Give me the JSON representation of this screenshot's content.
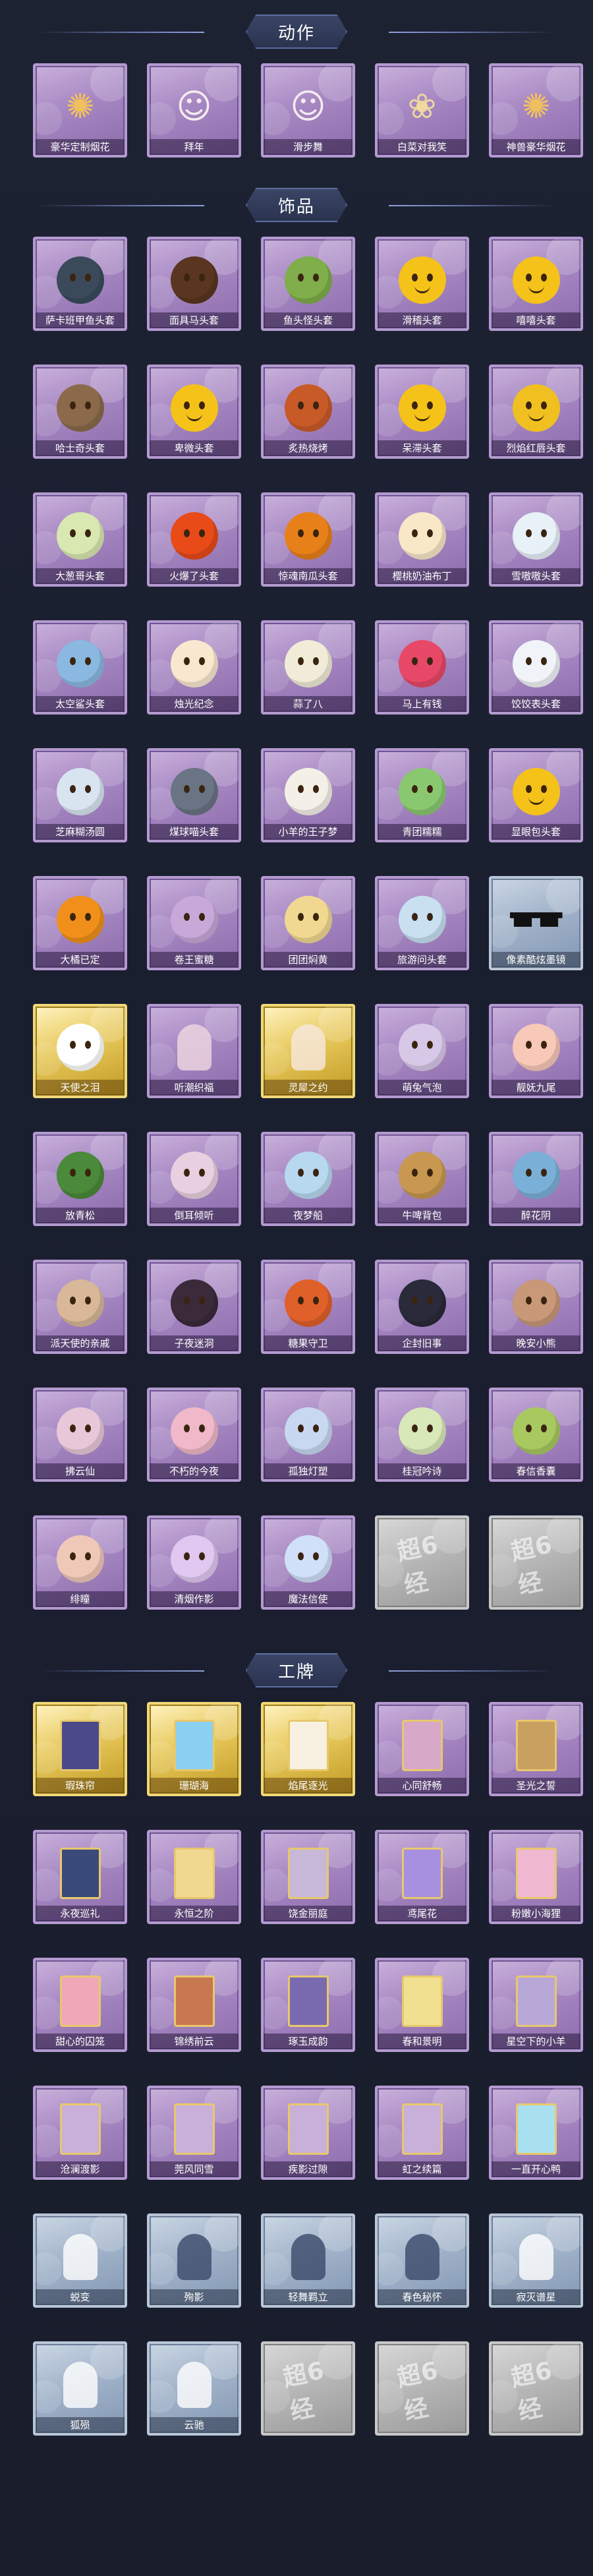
{
  "sections": [
    {
      "title": "动作",
      "items": [
        {
          "label": "豪华定制烟花",
          "style": "purple",
          "icon": "firework-icon"
        },
        {
          "label": "拜年",
          "style": "purple",
          "icon": "bowing-figure-icon"
        },
        {
          "label": "滑步舞",
          "style": "purple",
          "icon": "dancing-figure-icon"
        },
        {
          "label": "白菜对我笑",
          "style": "purple",
          "icon": "cabbage-smile-icon"
        },
        {
          "label": "神兽豪华烟花",
          "style": "purple",
          "icon": "beast-firework-icon"
        }
      ]
    },
    {
      "title": "饰品",
      "items": [
        {
          "label": "萨卡班甲鱼头套",
          "style": "purple",
          "icon": "fish-head-icon",
          "color": "#3a4a5a"
        },
        {
          "label": "面具马头套",
          "style": "purple",
          "icon": "horse-head-icon",
          "color": "#5a3520"
        },
        {
          "label": "鱼头怪头套",
          "style": "purple",
          "icon": "fish-monster-icon",
          "color": "#7fae4a"
        },
        {
          "label": "滑稽头套",
          "style": "purple",
          "icon": "smirk-emoji-icon",
          "color": "#f5c21a"
        },
        {
          "label": "嘻嘻头套",
          "style": "purple",
          "icon": "grin-emoji-icon",
          "color": "#f5c21a"
        },
        {
          "label": "哈士奇头套",
          "style": "purple",
          "icon": "husky-dog-icon",
          "color": "#8a6a4a"
        },
        {
          "label": "卑微头套",
          "style": "purple",
          "icon": "sad-emoji-icon",
          "color": "#f5c21a"
        },
        {
          "label": "炙热烧烤",
          "style": "purple",
          "icon": "bbq-toast-icon",
          "color": "#c85a28"
        },
        {
          "label": "呆滞头套",
          "style": "purple",
          "icon": "dull-emoji-icon",
          "color": "#f5c21a"
        },
        {
          "label": "烈焰红唇头套",
          "style": "purple",
          "icon": "red-lips-emoji-icon",
          "color": "#f0c020"
        },
        {
          "label": "大葱哥头套",
          "style": "purple",
          "icon": "scallion-icon",
          "color": "#d8e8b0"
        },
        {
          "label": "火爆了头套",
          "style": "purple",
          "icon": "fire-spirit-icon",
          "color": "#e84a18"
        },
        {
          "label": "惊魂南瓜头套",
          "style": "purple",
          "icon": "pumpkin-icon",
          "color": "#e8801a"
        },
        {
          "label": "樱桃奶油布丁",
          "style": "purple",
          "icon": "pudding-icon",
          "color": "#f8e8c8"
        },
        {
          "label": "雪嗷嗷头套",
          "style": "purple",
          "icon": "snow-creature-icon",
          "color": "#e8f0f8"
        },
        {
          "label": "太空鲨头套",
          "style": "purple",
          "icon": "space-shark-icon",
          "color": "#8ab8e0"
        },
        {
          "label": "烛光纪念",
          "style": "purple",
          "icon": "candle-icon",
          "color": "#f8e8d0"
        },
        {
          "label": "蒜了八",
          "style": "purple",
          "icon": "garlic-icon",
          "color": "#f0ecd8"
        },
        {
          "label": "马上有钱",
          "style": "purple",
          "icon": "pink-horse-icon",
          "color": "#e84868"
        },
        {
          "label": "饺饺表头套",
          "style": "purple",
          "icon": "dumpling-icon",
          "color": "#f0f4f8"
        },
        {
          "label": "芝麻糊汤圆",
          "style": "purple",
          "icon": "rice-ball-icon",
          "color": "#d8e4f0"
        },
        {
          "label": "煤球喵头套",
          "style": "purple",
          "icon": "gray-cat-icon",
          "color": "#6a7484"
        },
        {
          "label": "小羊的王子梦",
          "style": "purple",
          "icon": "sheep-prince-icon",
          "color": "#f4f0e8"
        },
        {
          "label": "青团糯糯",
          "style": "purple",
          "icon": "green-dumpling-icon",
          "color": "#8ac870"
        },
        {
          "label": "显眼包头套",
          "style": "purple",
          "icon": "showy-emoji-icon",
          "color": "#f5c21a"
        },
        {
          "label": "大橘已定",
          "style": "purple",
          "icon": "orange-icon",
          "color": "#f0901a"
        },
        {
          "label": "卷王蜜糖",
          "style": "purple",
          "icon": "honey-roll-icon",
          "color": "#c8a8d8"
        },
        {
          "label": "团团焖黄",
          "style": "purple",
          "icon": "bun-creature-icon",
          "color": "#f0d890"
        },
        {
          "label": "旅游问头套",
          "style": "purple",
          "icon": "tourist-hat-icon",
          "color": "#c8e0f0"
        },
        {
          "label": "像素酷炫墨镜",
          "style": "blue",
          "icon": "pixel-sunglasses-icon",
          "color": "#202020"
        },
        {
          "label": "天使之泪",
          "style": "gold",
          "icon": "angel-wings-icon",
          "color": "#ffffff"
        },
        {
          "label": "听潮织福",
          "style": "purple",
          "icon": "silhouette-icon",
          "color": "#f0d8e0"
        },
        {
          "label": "灵犀之约",
          "style": "gold",
          "icon": "silhouette-icon",
          "color": "#f8e8e0"
        },
        {
          "label": "萌兔气泡",
          "style": "purple",
          "icon": "bubble-bunny-icon",
          "color": "#d8c8e8"
        },
        {
          "label": "靓妩九尾",
          "style": "purple",
          "icon": "nine-tail-fox-icon",
          "color": "#f8c8b8"
        },
        {
          "label": "放青松",
          "style": "purple",
          "icon": "bonsai-pine-icon",
          "color": "#4a8a3a"
        },
        {
          "label": "倒耳倾听",
          "style": "purple",
          "icon": "lotus-halo-icon",
          "color": "#e8d0e0"
        },
        {
          "label": "夜梦船",
          "style": "purple",
          "icon": "dream-ship-icon",
          "color": "#b8d8f0"
        },
        {
          "label": "牛啤背包",
          "style": "purple",
          "icon": "beer-backpack-icon",
          "color": "#c89850"
        },
        {
          "label": "醉花阴",
          "style": "purple",
          "icon": "wind-chime-icon",
          "color": "#7ab0d8"
        },
        {
          "label": "派天使的亲戚",
          "style": "purple",
          "icon": "doll-figure-icon",
          "color": "#d8b898"
        },
        {
          "label": "子夜迷洞",
          "style": "purple",
          "icon": "dark-figure-icon",
          "color": "#3a2a3a"
        },
        {
          "label": "糖果守卫",
          "style": "purple",
          "icon": "candy-guard-icon",
          "color": "#e0602a"
        },
        {
          "label": "企封旧事",
          "style": "purple",
          "icon": "chibi-boy-icon",
          "color": "#2a2a3a"
        },
        {
          "label": "晚安小熊",
          "style": "purple",
          "icon": "teddy-bear-icon",
          "color": "#c89878"
        },
        {
          "label": "拂云仙",
          "style": "purple",
          "icon": "fairy-charm-icon",
          "color": "#e8c8d8"
        },
        {
          "label": "不朽的今夜",
          "style": "purple",
          "icon": "pink-bunny-icon",
          "color": "#f0b8c8"
        },
        {
          "label": "孤独灯塑",
          "style": "purple",
          "icon": "lantern-charm-icon",
          "color": "#c8d8f0"
        },
        {
          "label": "桂冠吟诗",
          "style": "purple",
          "icon": "laurel-charm-icon",
          "color": "#d8e8b8"
        },
        {
          "label": "春信香囊",
          "style": "purple",
          "icon": "sachet-icon",
          "color": "#a8c860"
        },
        {
          "label": "绯瞳",
          "style": "purple",
          "icon": "fox-girl-icon",
          "color": "#f0c8b8"
        },
        {
          "label": "清烟作影",
          "style": "purple",
          "icon": "mist-girl-icon",
          "color": "#e0c8f0"
        },
        {
          "label": "魔法信使",
          "style": "purple",
          "icon": "magic-mouse-icon",
          "color": "#d0e0f8"
        },
        {
          "label": "",
          "style": "gray",
          "icon": "super-coupon-icon",
          "stamp": "超6经"
        },
        {
          "label": "",
          "style": "gray",
          "icon": "super-coupon-icon",
          "stamp": "超6经"
        }
      ]
    },
    {
      "title": "工牌",
      "items": [
        {
          "label": "瑕珠帘",
          "style": "gold",
          "icon": "badge-card-icon",
          "color": "#4a4a8a"
        },
        {
          "label": "珊瑚海",
          "style": "gold",
          "icon": "badge-card-icon",
          "color": "#8ad0f0"
        },
        {
          "label": "焰尾逐光",
          "style": "gold",
          "icon": "badge-card-icon",
          "color": "#f8f0e0"
        },
        {
          "label": "心同舒畅",
          "style": "purple",
          "icon": "badge-card-icon",
          "color": "#d8a8c8"
        },
        {
          "label": "圣光之誓",
          "style": "purple",
          "icon": "badge-card-icon",
          "color": "#c8a060"
        },
        {
          "label": "永夜巡礼",
          "style": "purple",
          "icon": "badge-card-icon",
          "color": "#3a4a7a"
        },
        {
          "label": "永恒之阶",
          "style": "purple",
          "icon": "badge-card-icon",
          "color": "#f0d890"
        },
        {
          "label": "饶金丽庭",
          "style": "purple",
          "icon": "badge-card-icon",
          "color": "#c8b8d8"
        },
        {
          "label": "鸢尾花",
          "style": "purple",
          "icon": "badge-card-icon",
          "color": "#a890e0"
        },
        {
          "label": "粉嫩小海狸",
          "style": "purple",
          "icon": "badge-card-icon",
          "color": "#f0b8d0"
        },
        {
          "label": "甜心的囚笼",
          "style": "purple",
          "icon": "badge-card-icon",
          "color": "#f0a8b8"
        },
        {
          "label": "锦绣前云",
          "style": "purple",
          "icon": "badge-card-icon",
          "color": "#c87850"
        },
        {
          "label": "琢玉成韵",
          "style": "purple",
          "icon": "badge-card-icon",
          "color": "#7a6ab0"
        },
        {
          "label": "春和景明",
          "style": "purple",
          "icon": "badge-card-icon",
          "color": "#f0e090"
        },
        {
          "label": "星空下的小羊",
          "style": "purple",
          "icon": "badge-card-icon",
          "color": "#b8a8d8"
        },
        {
          "label": "沧澜渡影",
          "style": "purple",
          "icon": "badge-card-icon",
          "color": "#c8b0d8"
        },
        {
          "label": "莞风同雪",
          "style": "purple",
          "icon": "badge-card-icon",
          "color": "#c8b0d8"
        },
        {
          "label": "疾影过隙",
          "style": "purple",
          "icon": "badge-card-icon",
          "color": "#c8b0d8"
        },
        {
          "label": "虹之续篇",
          "style": "purple",
          "icon": "badge-card-icon",
          "color": "#c8b0d8"
        },
        {
          "label": "一直开心鸭",
          "style": "purple",
          "icon": "badge-card-icon",
          "color": "#a8e0f0"
        },
        {
          "label": "蜕变",
          "style": "blue",
          "icon": "silhouette-icon",
          "color": "#ffffff"
        },
        {
          "label": "殉影",
          "style": "blue",
          "icon": "silhouette-icon",
          "color": "#3a4a6a"
        },
        {
          "label": "轻舞羁立",
          "style": "blue",
          "icon": "silhouette-icon",
          "color": "#3a4a6a"
        },
        {
          "label": "春色秘怀",
          "style": "blue",
          "icon": "silhouette-icon",
          "color": "#3a4a6a"
        },
        {
          "label": "寂灭谱星",
          "style": "blue",
          "icon": "silhouette-icon",
          "color": "#ffffff"
        },
        {
          "label": "狐殒",
          "style": "blue",
          "icon": "silhouette-icon",
          "color": "#ffffff"
        },
        {
          "label": "云驰",
          "style": "blue",
          "icon": "silhouette-icon",
          "color": "#ffffff"
        },
        {
          "label": "",
          "style": "gray",
          "icon": "super-coupon-icon",
          "stamp": "超6经"
        },
        {
          "label": "",
          "style": "gray",
          "icon": "super-coupon-icon",
          "stamp": "超6经"
        },
        {
          "label": "",
          "style": "gray",
          "icon": "super-coupon-icon",
          "stamp": "超6经"
        }
      ]
    }
  ]
}
